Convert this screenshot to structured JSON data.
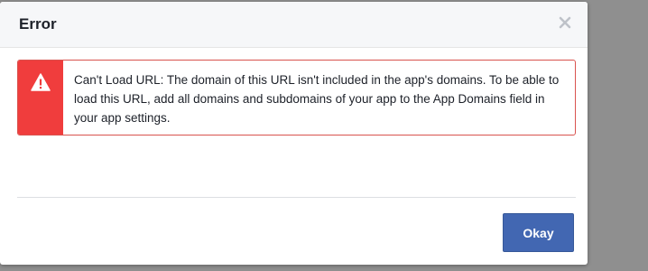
{
  "dialog": {
    "title": "Error",
    "close_icon": "close-icon",
    "error": {
      "icon": "warning-triangle-icon",
      "message": "Can't Load URL: The domain of this URL isn't included in the app's domains. To be able to load this URL, add all domains and subdomains of your app to the App Domains field in your app settings."
    },
    "okay_label": "Okay"
  },
  "colors": {
    "header_bg": "#f6f7f9",
    "error_accent": "#f03d3d",
    "error_border": "#d9534f",
    "button_primary": "#4267b2",
    "overlay": "#8f8f8f"
  }
}
